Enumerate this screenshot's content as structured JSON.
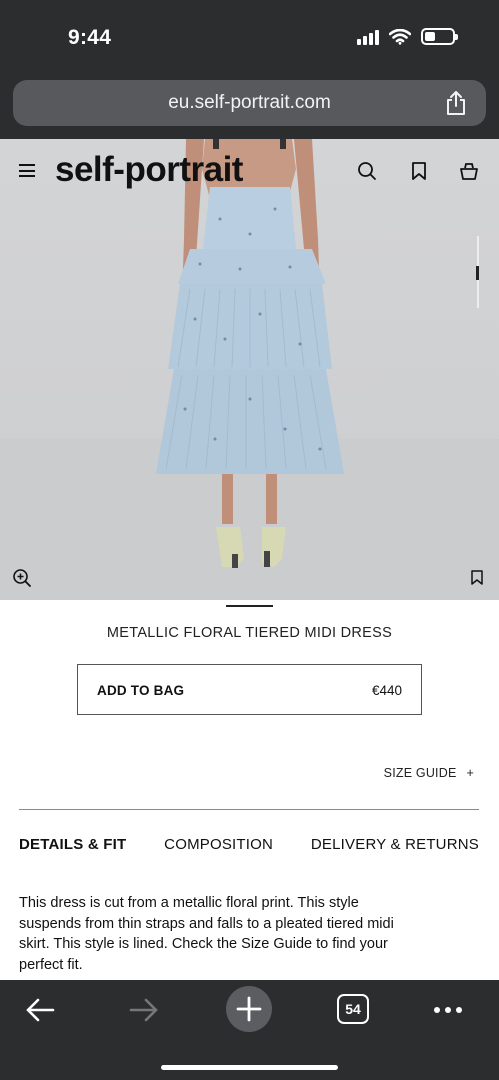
{
  "status_bar": {
    "time": "9:44"
  },
  "browser": {
    "url": "eu.self-portrait.com",
    "tab_count": "54"
  },
  "site": {
    "logo": "self-portrait"
  },
  "product": {
    "name": "METALLIC FLORAL TIERED MIDI DRESS",
    "add_to_bag_label": "ADD TO BAG",
    "price": "€440",
    "size_guide_label": "SIZE GUIDE",
    "size_guide_symbol": "+",
    "tabs": [
      "DETAILS & FIT",
      "COMPOSITION",
      "DELIVERY & RETURNS"
    ],
    "active_tab": "DETAILS & FIT",
    "description": "This dress is cut from a metallic floral print. This style suspends from thin straps and falls to a pleated tiered midi skirt. This style is lined. Check the Size Guide to find your perfect fit."
  },
  "icons": [
    "signal-icon",
    "wifi-icon",
    "battery-icon",
    "share-icon",
    "menu-icon",
    "search-icon",
    "bookmark-icon",
    "bag-icon",
    "zoom-icon",
    "back-icon",
    "forward-icon",
    "plus-icon",
    "tabs-icon",
    "more-icon"
  ],
  "colors": {
    "browser_chrome": "#2b2d2f",
    "url_bar": "#57595c",
    "dress": "#b8cde0"
  }
}
